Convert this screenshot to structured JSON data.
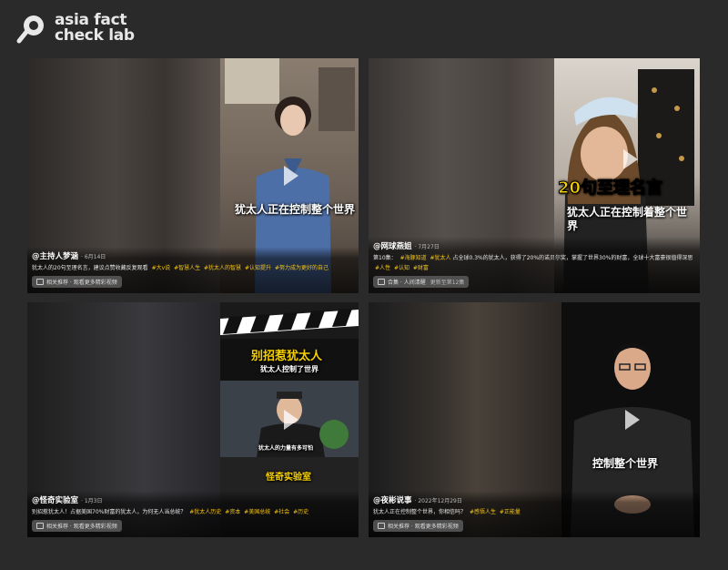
{
  "brand": {
    "line1": "asia fact",
    "line2": "check lab"
  },
  "cards": [
    {
      "author": "@主持人梦涵",
      "date": "· 6月14日",
      "text": "犹太人的20句至理名言，建议点赞收藏反复观看",
      "tags": [
        "#大v说",
        "#智慧人生",
        "#犹太人的智慧",
        "#认知提升",
        "#努力成为更好的自己"
      ],
      "caption": "犹太人正在控制整个世界",
      "chip": "相关推荐 · 观看更多精彩视频",
      "chip_sub": ""
    },
    {
      "author": "@网球燕姐",
      "date": "· 7月27日",
      "text": "第10集：",
      "tags": [
        "#海豚知道",
        "#犹太人"
      ],
      "text2": "占全球0.3%的犹太人，获得了20%的诺贝尔奖，掌握了世界30%的财富，全球十大富豪很值得深思",
      "tags2": [
        "#人性",
        "#认知",
        "#财富"
      ],
      "title_overlay": "20句至理名言",
      "caption": "犹太人正在控制着整个世界",
      "chip": "合集 · 人间清醒",
      "chip_sub": "更新至第12集"
    },
    {
      "author": "@怪奇实验室",
      "date": "· 1月3日",
      "text": "别招惹犹太人！占据美国70%财富的犹太人，为何无人当总统？",
      "tags": [
        "#犹太人历史",
        "#资本",
        "#美国总统",
        "#社会",
        "#历史"
      ],
      "title_overlay": "别招惹犹太人",
      "subtitle_overlay": "犹太人控制了世界",
      "inner_caption": "犹太人的力量有多可怕",
      "footer_overlay": "怪奇实验室",
      "caption": "",
      "chip": "相关推荐 · 观看更多精彩视频",
      "chip_sub": ""
    },
    {
      "author": "@夜彬说事",
      "date": "· 2022年12月29日",
      "text": "犹太人正在控制整个世界，你相信吗？",
      "tags": [
        "#感悟人生",
        "#正能量"
      ],
      "caption": "控制整个世界",
      "chip": "相关推荐 · 观看更多精彩视频",
      "chip_sub": ""
    }
  ]
}
